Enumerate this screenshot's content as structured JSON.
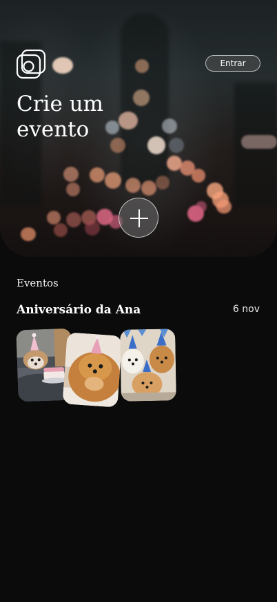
{
  "header": {
    "login_label": "Entrar",
    "title": "Crie um evento",
    "logo_icon": "camera-frame-icon",
    "add_icon": "plus-icon"
  },
  "events": {
    "section_title": "Eventos",
    "items": [
      {
        "name": "Aniversário da Ana",
        "date": "6 nov",
        "photos": [
          "dog-party-hat-cake-photo",
          "pomeranian-party-hat-photo",
          "three-dogs-party-hats-photo"
        ]
      }
    ]
  },
  "colors": {
    "background": "#0b0b0b",
    "text": "#ffffff",
    "bokeh_warm": "#f0a27a",
    "bokeh_pink": "#e8688a"
  }
}
